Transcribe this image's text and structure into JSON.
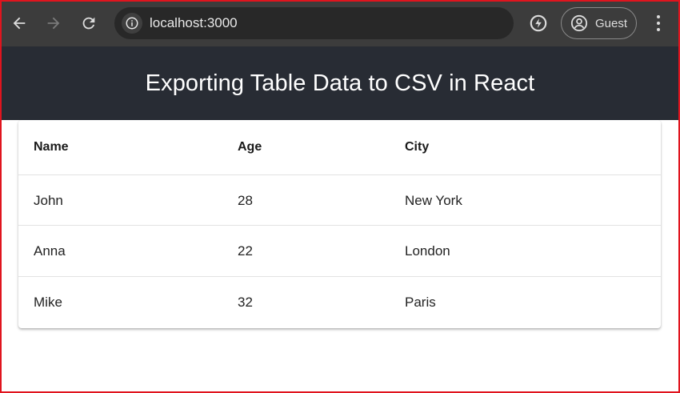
{
  "browser": {
    "url": "localhost:3000",
    "profile_label": "Guest",
    "icons": [
      "back-arrow-icon",
      "forward-arrow-icon",
      "reload-icon",
      "info-icon",
      "extension-icon",
      "profile-icon",
      "more-vert-icon"
    ]
  },
  "app": {
    "title": "Exporting Table Data to CSV in React"
  },
  "table": {
    "headers": [
      "Name",
      "Age",
      "City"
    ],
    "rows": [
      [
        "John",
        "28",
        "New York"
      ],
      [
        "Anna",
        "22",
        "London"
      ],
      [
        "Mike",
        "32",
        "Paris"
      ]
    ]
  },
  "colors": {
    "browser_toolbar": "#3c3c3c",
    "omnibox": "#282828",
    "header_bg": "#282c34",
    "header_text": "#ffffff",
    "frame_border": "#e0141e"
  }
}
